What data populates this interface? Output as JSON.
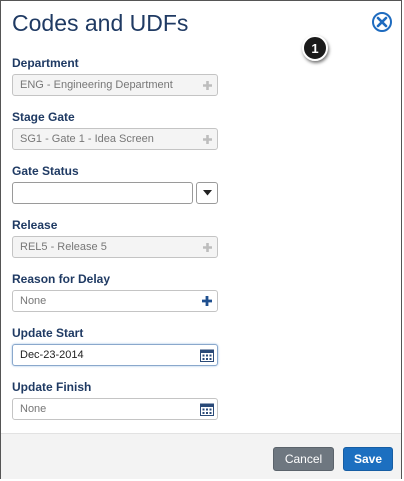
{
  "dialog": {
    "title": "Codes and UDFs",
    "close_icon": "close-circle-icon",
    "callout_number": "1"
  },
  "fields": {
    "department": {
      "label": "Department",
      "value": "ENG - Engineering Department",
      "icon": "plus-icon",
      "disabled": true
    },
    "stage_gate": {
      "label": "Stage Gate",
      "value": "SG1 - Gate 1 - Idea Screen",
      "icon": "plus-icon",
      "disabled": true
    },
    "gate_status": {
      "label": "Gate Status",
      "value": "",
      "icon": "chevron-down-icon"
    },
    "release": {
      "label": "Release",
      "value": "REL5 - Release 5",
      "icon": "plus-icon",
      "disabled": true
    },
    "reason_for_delay": {
      "label": "Reason for Delay",
      "placeholder": "None",
      "icon": "plus-icon"
    },
    "update_start": {
      "label": "Update Start",
      "value": "Dec-23-2014",
      "icon": "calendar-icon"
    },
    "update_finish": {
      "label": "Update Finish",
      "placeholder": "None",
      "icon": "calendar-icon"
    }
  },
  "footer": {
    "cancel_label": "Cancel",
    "save_label": "Save"
  },
  "colors": {
    "title": "#1f3a63",
    "save": "#1c6fc0",
    "cancel": "#6e7780",
    "icon_blue": "#1e6bbf"
  }
}
